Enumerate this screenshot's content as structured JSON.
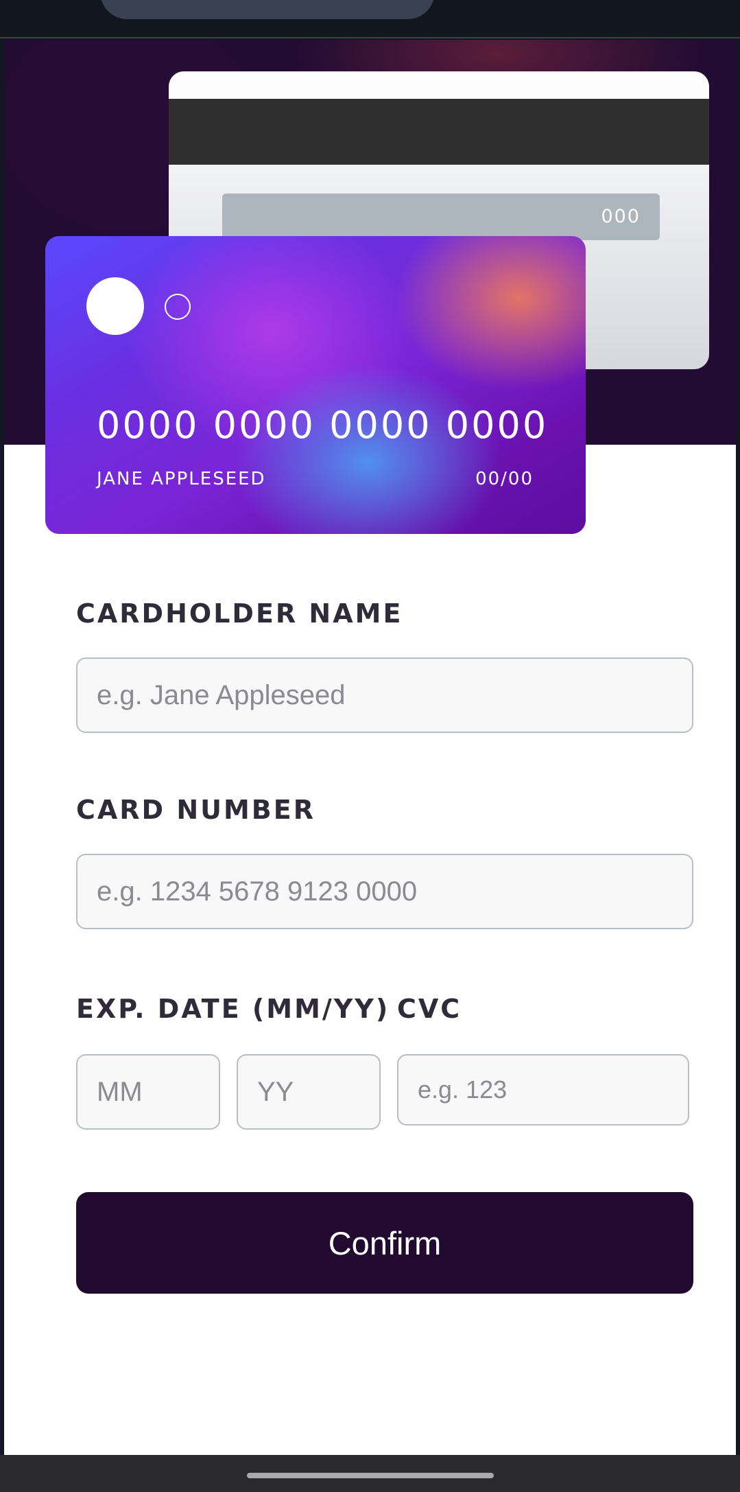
{
  "card_back": {
    "cvc": "000"
  },
  "card_front": {
    "number": "0000 0000 0000 0000",
    "name": "JANE APPLESEED",
    "expiry": "00/00"
  },
  "form": {
    "cardholder_label": "CARDHOLDER NAME",
    "cardholder_placeholder": "e.g. Jane Appleseed",
    "number_label": "CARD NUMBER",
    "number_placeholder": "e.g. 1234 5678 9123 0000",
    "expiry_label": "EXP. DATE (MM/YY)",
    "month_placeholder": "MM",
    "year_placeholder": "YY",
    "cvc_label": "CVC",
    "cvc_placeholder": "e.g. 123",
    "confirm_label": "Confirm"
  },
  "colors": {
    "hero_background": "#230c33",
    "button_background": "#22092f",
    "input_border": "#b9bdc6"
  }
}
